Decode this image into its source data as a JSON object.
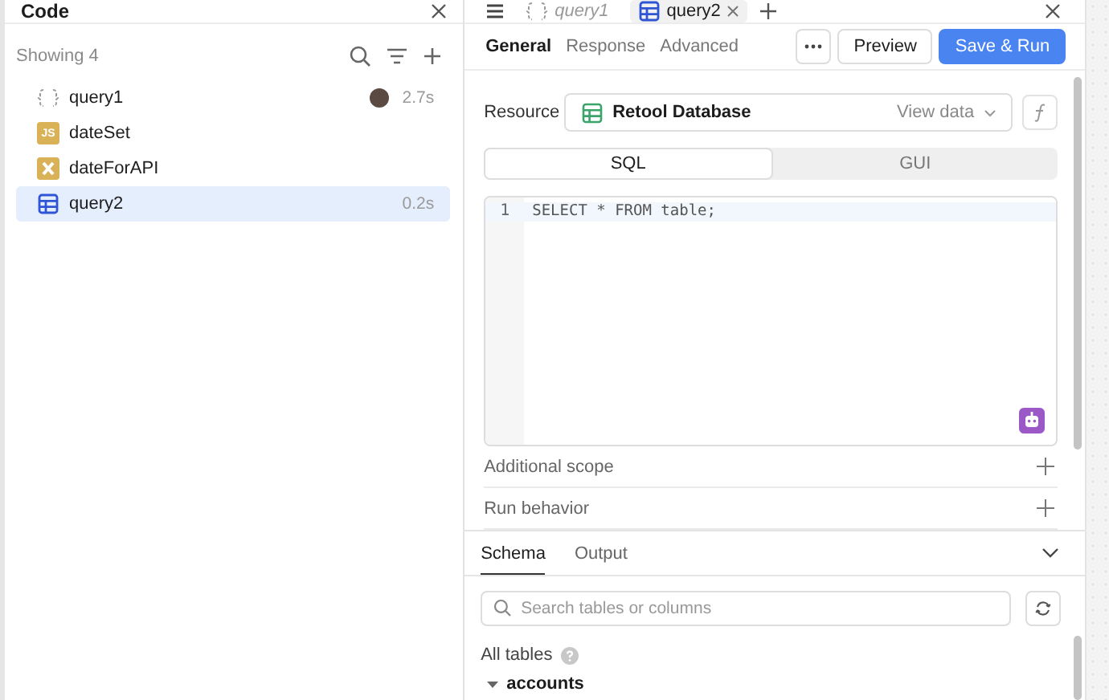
{
  "left_panel": {
    "title": "Code",
    "count_label": "Showing 4",
    "items": [
      {
        "name": "query1",
        "kind": "query",
        "time": "2.7s",
        "avatar": true,
        "selected": false
      },
      {
        "name": "dateSet",
        "kind": "js",
        "icon_text": "JS",
        "avatar": false,
        "selected": false
      },
      {
        "name": "dateForAPI",
        "kind": "transformer",
        "avatar": false,
        "selected": false
      },
      {
        "name": "query2",
        "kind": "table",
        "time": "0.2s",
        "avatar": false,
        "selected": true
      }
    ]
  },
  "editor_tabs": [
    {
      "label": "query1",
      "kind": "query",
      "selected": false
    },
    {
      "label": "query2",
      "kind": "table",
      "selected": true
    }
  ],
  "sub_tabs": [
    {
      "label": "General",
      "selected": true
    },
    {
      "label": "Response",
      "selected": false
    },
    {
      "label": "Advanced",
      "selected": false
    }
  ],
  "buttons": [
    {
      "label": "Preview",
      "kind": "secondary"
    },
    {
      "label": "Save & Run",
      "kind": "primary"
    }
  ],
  "resource": {
    "label": "Resource",
    "value": "Retool Database",
    "action": "View data"
  },
  "mode_tabs": [
    {
      "label": "SQL",
      "selected": true
    },
    {
      "label": "GUI",
      "selected": false
    }
  ],
  "code": {
    "lines": [
      {
        "number": "1",
        "text": "SELECT * FROM table;"
      }
    ]
  },
  "sections": [
    {
      "label": "Additional scope"
    },
    {
      "label": "Run behavior"
    }
  ],
  "bottom_tabs": [
    {
      "label": "Schema",
      "selected": true
    },
    {
      "label": "Output",
      "selected": false
    }
  ],
  "schema_search": {
    "placeholder": "Search tables or columns"
  },
  "tables_heading": "All tables",
  "tables": [
    {
      "name": "accounts",
      "expanded": true
    }
  ]
}
